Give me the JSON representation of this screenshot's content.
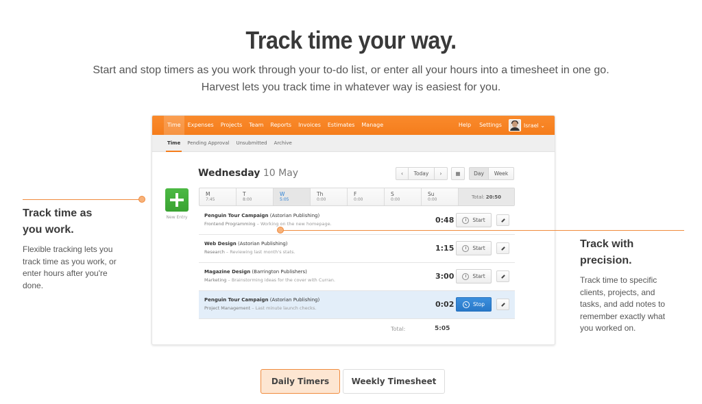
{
  "hero": {
    "title": "Track time your way.",
    "subtitle": "Start and stop timers as you work through your to-do list, or enter all your hours into a timesheet in one go. Harvest lets you track time in whatever way is easiest for you."
  },
  "app": {
    "nav": {
      "items": [
        "Time",
        "Expenses",
        "Projects",
        "Team",
        "Reports",
        "Invoices",
        "Estimates",
        "Manage"
      ],
      "active": "Time",
      "right": [
        "Help",
        "Settings"
      ],
      "user": "Israel ⌄"
    },
    "subnav": {
      "items": [
        "Time",
        "Pending Approval",
        "Unsubmitted",
        "Archive"
      ],
      "active": "Time"
    },
    "date": {
      "weekday": "Wednesday",
      "date": "10 May"
    },
    "controls": {
      "prev": "‹",
      "today": "Today",
      "next": "›",
      "calendar_icon": "▦",
      "day": "Day",
      "week": "Week"
    },
    "new_entry_label": "New Entry",
    "week": {
      "days": [
        {
          "label": "M",
          "hours": "7:45"
        },
        {
          "label": "T",
          "hours": "8:00"
        },
        {
          "label": "W",
          "hours": "5:05",
          "active": true
        },
        {
          "label": "Th",
          "hours": "0:00"
        },
        {
          "label": "F",
          "hours": "0:00"
        },
        {
          "label": "S",
          "hours": "0:00"
        },
        {
          "label": "Su",
          "hours": "0:00"
        }
      ],
      "total_label": "Total:",
      "total_value": "20:50"
    },
    "entries": [
      {
        "project": "Penguin Tour Campaign",
        "client": "(Astorian Publishing)",
        "task": "Frontend Programming",
        "note": "Working on the new homepage.",
        "time": "0:48",
        "action": "Start",
        "running": false
      },
      {
        "project": "Web Design",
        "client": "(Astorian Publishing)",
        "task": "Research",
        "note": "Reviewing last month's stats.",
        "time": "1:15",
        "action": "Start",
        "running": false
      },
      {
        "project": "Magazine Design",
        "client": "(Barrington Publishers)",
        "task": "Marketing",
        "note": "Brainstorming ideas for the cover with Curran.",
        "time": "3:00",
        "action": "Start",
        "running": false
      },
      {
        "project": "Penguin Tour Campaign",
        "client": "(Astorian Publishing)",
        "task": "Project Management",
        "note": "Last minute launch checks.",
        "time": "0:02",
        "action": "Stop",
        "running": true
      }
    ],
    "separator": "–",
    "day_total_label": "Total:",
    "day_total_value": "5:05"
  },
  "callouts": {
    "left": {
      "title_line1": "Track time as",
      "title_line2": "you work.",
      "text": "Flexible tracking lets you track time as you work, or enter hours after you're done."
    },
    "right": {
      "title_line1": "Track with",
      "title_line2": "precision.",
      "text": "Track time to specific clients, projects, and tasks, and add notes to remember exactly what you worked on."
    }
  },
  "toggle": {
    "active": "Daily Timers",
    "inactive": "Weekly Timesheet"
  },
  "colors": {
    "brand_orange": "#f57d1c",
    "new_entry_green": "#3fa937",
    "stop_blue": "#2a7fd4",
    "running_row": "#e3eef9"
  }
}
